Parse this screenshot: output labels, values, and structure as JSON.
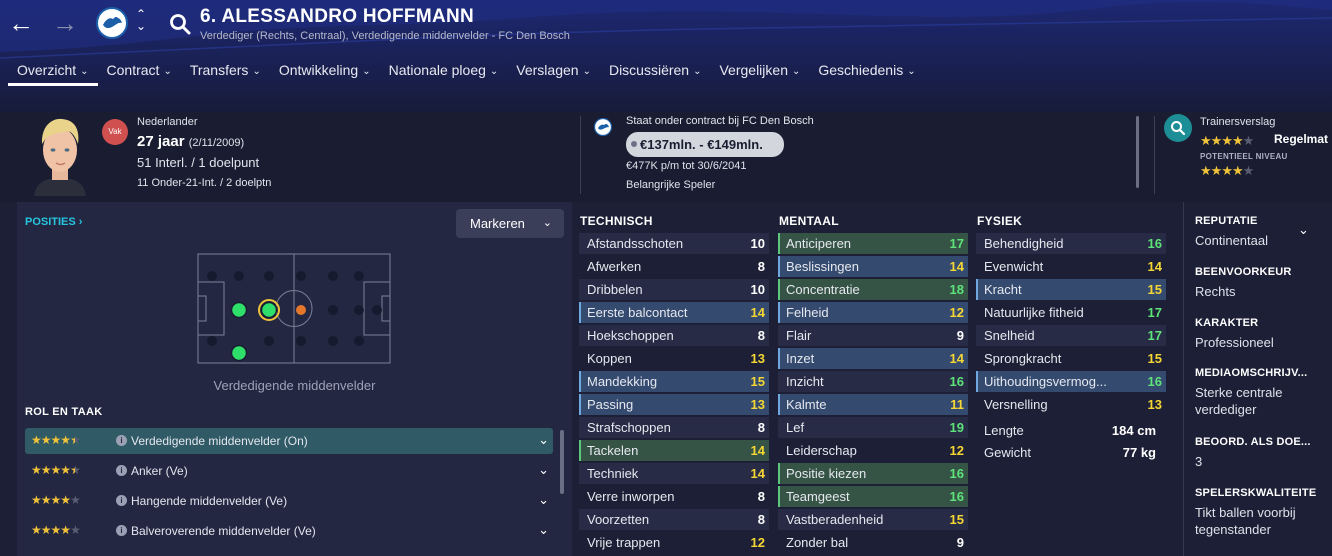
{
  "header": {
    "title": "6. ALESSANDRO HOFFMANN",
    "subtitle": "Verdediger (Rechts, Centraal), Verdedigende middenvelder - FC Den Bosch",
    "back_icon": "←",
    "forward_icon": "→",
    "sort_icon": "⌃⌄"
  },
  "tabs": [
    {
      "label": "Overzicht"
    },
    {
      "label": "Contract"
    },
    {
      "label": "Transfers"
    },
    {
      "label": "Ontwikkeling"
    },
    {
      "label": "Nationale ploeg"
    },
    {
      "label": "Verslagen"
    },
    {
      "label": "Discussiëren"
    },
    {
      "label": "Vergelijken"
    },
    {
      "label": "Geschiedenis"
    }
  ],
  "profile": {
    "vak_badge": "Vak",
    "nationality": "Nederlander",
    "age": "27 jaar",
    "birthdate": "(2/11/2009)",
    "caps": "51 Interl. / 1 doelpunt",
    "u21": "11 Onder-21-Int. / 2 doelptn"
  },
  "contract": {
    "line": "Staat onder contract bij FC Den Bosch",
    "value": "€137mln. - €149mln.",
    "wage": "€477K p/m tot 30/6/2041",
    "status": "Belangrijke Speler"
  },
  "report": {
    "title": "Trainersverslag",
    "current_stars": 4,
    "label": "Regelmat",
    "potential_label": "POTENTIEEL NIVEAU",
    "potential_stars": 4
  },
  "positions": {
    "title": "POSITIES ›",
    "mark_button": "Markeren",
    "caption": "Verdedigende middenvelder",
    "role_title": "ROL EN TAAK",
    "roles": [
      {
        "name": "Verdedigende middenvelder (On)",
        "stars": 4.5
      },
      {
        "name": "Anker (Ve)",
        "stars": 4.5
      },
      {
        "name": "Hangende middenvelder (Ve)",
        "stars": 4
      },
      {
        "name": "Balveroverende middenvelder (Ve)",
        "stars": 4
      }
    ]
  },
  "attributes": {
    "technical": {
      "title": "TECHNISCH",
      "rows": [
        {
          "name": "Afstandsschoten",
          "value": 10
        },
        {
          "name": "Afwerken",
          "value": 8
        },
        {
          "name": "Dribbelen",
          "value": 10
        },
        {
          "name": "Eerste balcontact",
          "value": 14,
          "hl": "blue"
        },
        {
          "name": "Hoekschoppen",
          "value": 8
        },
        {
          "name": "Koppen",
          "value": 13
        },
        {
          "name": "Mandekking",
          "value": 15,
          "hl": "blue"
        },
        {
          "name": "Passing",
          "value": 13,
          "hl": "blue"
        },
        {
          "name": "Strafschoppen",
          "value": 8
        },
        {
          "name": "Tackelen",
          "value": 14,
          "hl": "green"
        },
        {
          "name": "Techniek",
          "value": 14
        },
        {
          "name": "Verre inworpen",
          "value": 8
        },
        {
          "name": "Voorzetten",
          "value": 8
        },
        {
          "name": "Vrije trappen",
          "value": 12
        }
      ]
    },
    "mental": {
      "title": "MENTAAL",
      "rows": [
        {
          "name": "Anticiperen",
          "value": 17,
          "hl": "green"
        },
        {
          "name": "Beslissingen",
          "value": 14,
          "hl": "blue"
        },
        {
          "name": "Concentratie",
          "value": 18,
          "hl": "green"
        },
        {
          "name": "Felheid",
          "value": 12,
          "hl": "blue"
        },
        {
          "name": "Flair",
          "value": 9
        },
        {
          "name": "Inzet",
          "value": 14,
          "hl": "blue"
        },
        {
          "name": "Inzicht",
          "value": 16
        },
        {
          "name": "Kalmte",
          "value": 11,
          "hl": "blue"
        },
        {
          "name": "Lef",
          "value": 19
        },
        {
          "name": "Leiderschap",
          "value": 12
        },
        {
          "name": "Positie kiezen",
          "value": 16,
          "hl": "green"
        },
        {
          "name": "Teamgeest",
          "value": 16,
          "hl": "green"
        },
        {
          "name": "Vastberadenheid",
          "value": 15
        },
        {
          "name": "Zonder bal",
          "value": 9
        }
      ]
    },
    "physical": {
      "title": "FYSIEK",
      "rows": [
        {
          "name": "Behendigheid",
          "value": 16
        },
        {
          "name": "Evenwicht",
          "value": 14
        },
        {
          "name": "Kracht",
          "value": 15,
          "hl": "blue"
        },
        {
          "name": "Natuurlijke fitheid",
          "value": 17
        },
        {
          "name": "Snelheid",
          "value": 17
        },
        {
          "name": "Sprongkracht",
          "value": 15
        },
        {
          "name": "Uithoudingsvermog...",
          "value": 16,
          "hl": "blue"
        },
        {
          "name": "Versnelling",
          "value": 13
        }
      ],
      "extra": [
        {
          "name": "Lengte",
          "value": "184 cm"
        },
        {
          "name": "Gewicht",
          "value": "77 kg"
        }
      ]
    }
  },
  "info": [
    {
      "head": "REPUTATIE",
      "value": "Continentaal"
    },
    {
      "head": "BEENVOORKEUR",
      "value": "Rechts"
    },
    {
      "head": "KARAKTER",
      "value": "Professioneel"
    },
    {
      "head": "MEDIAOMSCHRIJV...",
      "value": "Sterke centrale verdediger"
    },
    {
      "head": "BEOORD. ALS DOE...",
      "value": "3"
    },
    {
      "head": "SPELERSKWALITEITE",
      "value": "Tikt ballen voorbij tegenstander"
    }
  ],
  "colors": {
    "accent": "#27c6e0",
    "star": "#f0c23a",
    "value_green": "#5ee27a",
    "value_yellow": "#f4d634"
  },
  "icons": {
    "search": "search-icon",
    "chevron": "chevron-down-icon",
    "info": "info-icon"
  }
}
